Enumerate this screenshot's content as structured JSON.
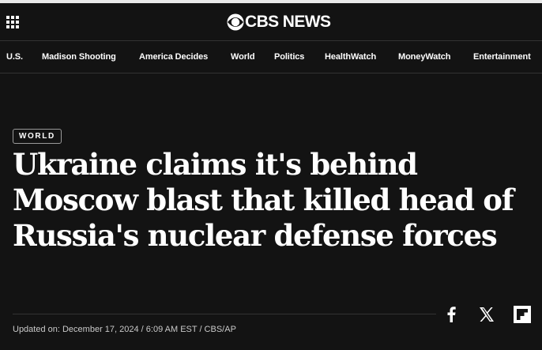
{
  "header": {
    "logo_text": "CBS NEWS",
    "menu_icon": "grid-menu-icon",
    "logo_icon": "cbs-eye-icon"
  },
  "nav": {
    "items": [
      {
        "label": "U.S."
      },
      {
        "label": "Madison Shooting"
      },
      {
        "label": "America Decides"
      },
      {
        "label": "World"
      },
      {
        "label": "Politics"
      },
      {
        "label": "HealthWatch"
      },
      {
        "label": "MoneyWatch"
      },
      {
        "label": "Entertainment"
      }
    ]
  },
  "article": {
    "category": "WORLD",
    "headline": "Ukraine claims it's behind Moscow blast that killed head of Russia's nuclear defense forces",
    "byline": "Updated on: December 17, 2024 / 6:09 AM EST / CBS/AP"
  },
  "share": {
    "icons": [
      "facebook-icon",
      "x-icon",
      "flipboard-icon"
    ]
  },
  "colors": {
    "background": "#131313",
    "text": "#ffffff",
    "muted": "#c9c9c9"
  }
}
